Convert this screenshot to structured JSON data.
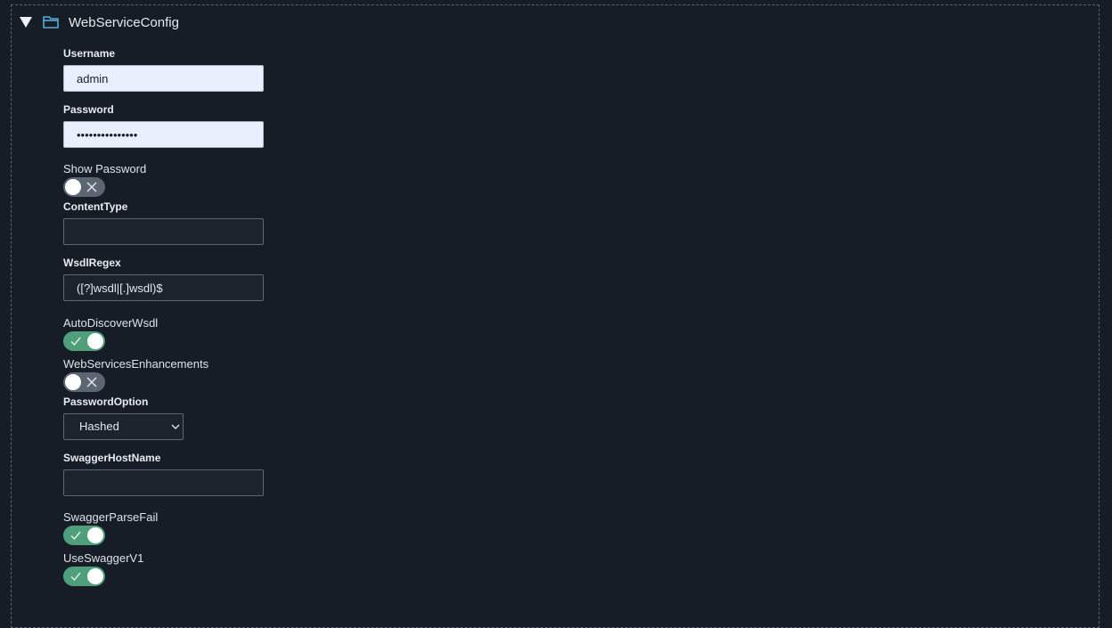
{
  "section": {
    "title": "WebServiceConfig",
    "expanded": true,
    "expand_icon": "caret-down-icon",
    "section_icon": "folder-open-icon"
  },
  "fields": {
    "username": {
      "label": "Username",
      "value": "admin"
    },
    "password": {
      "label": "Password",
      "value": "•••••••••••••••"
    },
    "show_password": {
      "label": "Show Password",
      "checked": false
    },
    "content_type": {
      "label": "ContentType",
      "value": ""
    },
    "wsdl_regex": {
      "label": "WsdlRegex",
      "value": "([?]wsdl|[.]wsdl)$"
    },
    "auto_discover_wsdl": {
      "label": "AutoDiscoverWsdl",
      "checked": true
    },
    "web_services_enhancements": {
      "label": "WebServicesEnhancements",
      "checked": false
    },
    "password_option": {
      "label": "PasswordOption",
      "selected": "Hashed"
    },
    "swagger_host_name": {
      "label": "SwaggerHostName",
      "value": ""
    },
    "swagger_parse_fail": {
      "label": "SwaggerParseFail",
      "checked": true
    },
    "use_swagger_v1": {
      "label": "UseSwaggerV1",
      "checked": true
    }
  },
  "colors": {
    "background": "#161d26",
    "toggle_on": "#4fa07a",
    "toggle_off": "#5b6672",
    "input_filled": "#e8f0fd",
    "accent_icon": "#5aa9d6"
  }
}
